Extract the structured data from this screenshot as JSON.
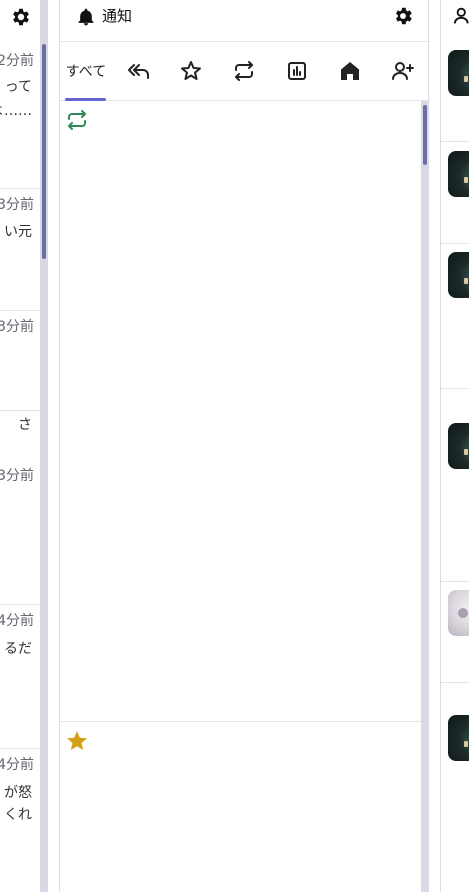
{
  "left_column": {
    "items": [
      {
        "time": "2分前",
        "snippet": [
          "って",
          "よ……"
        ]
      },
      {
        "time": "3分前",
        "snippet": [
          "い元"
        ]
      },
      {
        "time": "3分前",
        "snippet": []
      },
      {
        "time": "3分前",
        "snippet": [
          "さ"
        ]
      },
      {
        "time": "4分前",
        "snippet": [
          "るだ"
        ]
      },
      {
        "time": "4分前",
        "snippet": [
          "が怒",
          "くれ"
        ]
      }
    ]
  },
  "notifications_column": {
    "title": "通知",
    "tabs": [
      {
        "label": "すべて",
        "icon": null,
        "active": true
      },
      {
        "label": "",
        "icon": "reply-all-icon",
        "active": false
      },
      {
        "label": "",
        "icon": "star-icon",
        "active": false
      },
      {
        "label": "",
        "icon": "repost-icon",
        "active": false
      },
      {
        "label": "",
        "icon": "poll-icon",
        "active": false
      },
      {
        "label": "",
        "icon": "home-icon",
        "active": false
      },
      {
        "label": "",
        "icon": "follow-icon",
        "active": false
      }
    ],
    "notifications": [
      {
        "type": "repost",
        "icon": "repost-icon",
        "icon_color": "#2e8b57"
      },
      {
        "type": "favourite",
        "icon": "star-icon",
        "icon_color": "#d4a017"
      }
    ]
  },
  "right_column": {
    "avatars": [
      "dark",
      "dark",
      "dark",
      "dark",
      "light",
      "dark"
    ]
  },
  "colors": {
    "accent": "#6366d1",
    "repost_green": "#2e8b57",
    "favourite_gold": "#d4a017",
    "scrollbar_track": "#d9d9e6",
    "scrollbar_thumb": "#6b6fa6"
  }
}
